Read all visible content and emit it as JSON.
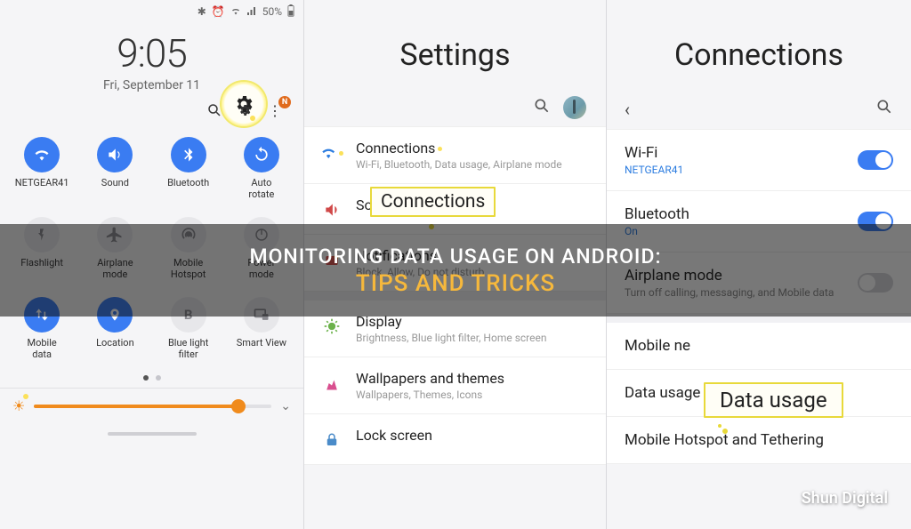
{
  "status": {
    "battery": "50%",
    "icons": [
      "bluetooth",
      "alarm",
      "wifi",
      "signal"
    ]
  },
  "clock": {
    "time": "9:05",
    "date": "Fri, September 11"
  },
  "topicons": {
    "search": "search-icon",
    "gear": "gear-icon",
    "more": "more-icon",
    "badge": "N"
  },
  "qs": [
    {
      "id": "wifi",
      "label": "NETGEAR41",
      "on": true,
      "glyph": "wifi"
    },
    {
      "id": "sound",
      "label": "Sound",
      "on": true,
      "glyph": "volume"
    },
    {
      "id": "bluetooth",
      "label": "Bluetooth",
      "on": true,
      "glyph": "bluetooth"
    },
    {
      "id": "autorotate",
      "label": "Auto\nrotate",
      "on": true,
      "glyph": "rotate"
    },
    {
      "id": "flashlight",
      "label": "Flashlight",
      "on": false,
      "glyph": "flash"
    },
    {
      "id": "airplane",
      "label": "Airplane\nmode",
      "on": false,
      "glyph": "airplane"
    },
    {
      "id": "hotspot",
      "label": "Mobile\nHotspot",
      "on": false,
      "glyph": "hotspot"
    },
    {
      "id": "power",
      "label": "Power\nmode",
      "on": false,
      "glyph": "power"
    },
    {
      "id": "mobiledata",
      "label": "Mobile\ndata",
      "on": true,
      "glyph": "updown"
    },
    {
      "id": "location",
      "label": "Location",
      "on": true,
      "glyph": "pin"
    },
    {
      "id": "bluelight",
      "label": "Blue light\nfilter",
      "on": false,
      "glyph": "bluelight"
    },
    {
      "id": "smartview",
      "label": "Smart View",
      "on": false,
      "glyph": "smartview"
    }
  ],
  "brightness": {
    "percent": 86
  },
  "settings": {
    "title": "Settings",
    "callout": "Connections",
    "rows": [
      {
        "icon": "wifi",
        "title": "Connections",
        "desc": "Wi-Fi, Bluetooth, Data usage, Airplane mode"
      },
      {
        "icon": "sound",
        "title": "Sounds and vibration",
        "desc": ""
      },
      {
        "icon": "notif",
        "title": "Notifications",
        "desc": "Block, Allow, Do not disturb"
      },
      {
        "icon": "disp",
        "title": "Display",
        "desc": "Brightness, Blue light filter, Home screen"
      },
      {
        "icon": "wall",
        "title": "Wallpapers and themes",
        "desc": "Wallpapers, Themes, Icons"
      },
      {
        "icon": "lock",
        "title": "Lock screen",
        "desc": ""
      }
    ]
  },
  "connections": {
    "title": "Connections",
    "callout": "Data usage",
    "rows": [
      {
        "title": "Wi-Fi",
        "desc": "NETGEAR41",
        "descColor": "blue",
        "toggle": "on"
      },
      {
        "title": "Bluetooth",
        "desc": "On",
        "descColor": "blue",
        "toggle": "on"
      },
      {
        "title": "Airplane mode",
        "desc": "Turn off calling, messaging, and Mobile data",
        "descColor": "gray",
        "toggle": "off"
      },
      {
        "title": "Mobile networks",
        "desc": "",
        "toggle": null,
        "gapBefore": true
      },
      {
        "title": "Data usage",
        "desc": "",
        "toggle": null
      },
      {
        "title": "Mobile Hotspot and Tethering",
        "desc": "",
        "toggle": null
      }
    ]
  },
  "overlay": {
    "line1": "MONITORING DATA USAGE ON ANDROID:",
    "line2": "TIPS AND TRICKS"
  },
  "brand": "Shun Digital"
}
